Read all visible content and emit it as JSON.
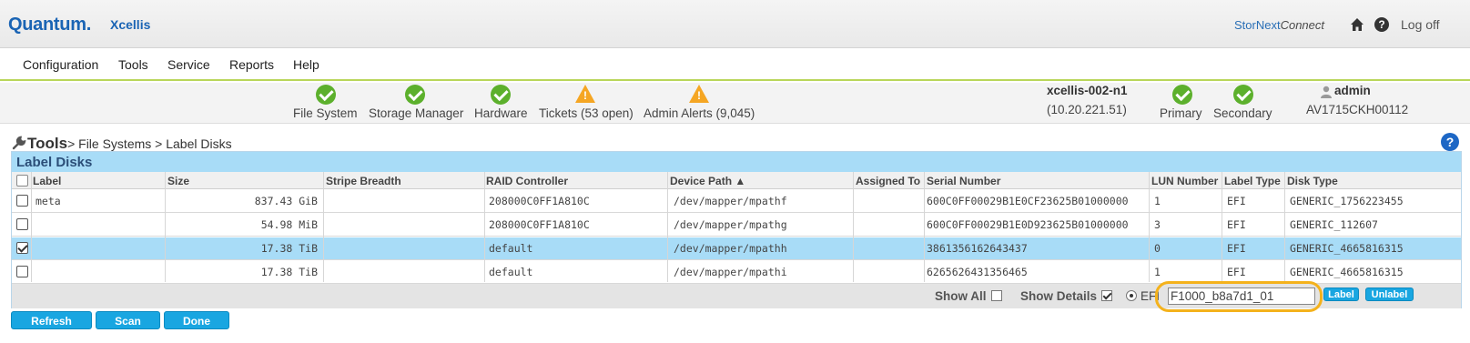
{
  "header": {
    "brand": "Quantum",
    "brand_dot": ".",
    "product": "Xcellis",
    "stornext_a": "StorNext",
    "stornext_b": "Connect",
    "help_icon": "?",
    "logoff": "Log off"
  },
  "menu": [
    "Configuration",
    "Tools",
    "Service",
    "Reports",
    "Help"
  ],
  "status": {
    "items": [
      {
        "label": "File System",
        "state": "ok"
      },
      {
        "label": "Storage Manager",
        "state": "ok"
      },
      {
        "label": "Hardware",
        "state": "ok"
      },
      {
        "label": "Tickets (53 open)",
        "state": "warn"
      },
      {
        "label": "Admin Alerts (9,045)",
        "state": "warn"
      }
    ],
    "warn_glyph": "!",
    "node_name": "xcellis-002-n1",
    "node_ip": "(10.20.221.51)",
    "primary": "Primary",
    "secondary": "Secondary",
    "user": "admin",
    "serial": "AV1715CKH00112"
  },
  "breadcrumb": {
    "root": "Tools",
    "path": "> File Systems > Label Disks",
    "help": "?"
  },
  "panel": {
    "title": "Label Disks",
    "columns": {
      "label": "Label",
      "size": "Size",
      "stripe": "Stripe Breadth",
      "raid": "RAID Controller",
      "device": "Device Path",
      "device_sort": "▲",
      "assigned": "Assigned To",
      "serial": "Serial Number",
      "lun": "LUN Number",
      "label_type": "Label Type",
      "disk_type": "Disk Type"
    },
    "rows": [
      {
        "checked": false,
        "label": "meta",
        "size": "837.43 GiB",
        "stripe": "",
        "raid": "208000C0FF1A810C",
        "device": "/dev/mapper/mpathf",
        "assigned": "",
        "serial": "600C0FF00029B1E0CF23625B01000000",
        "lun": "1",
        "label_type": "EFI",
        "disk_type": "GENERIC_1756223455"
      },
      {
        "checked": false,
        "label": "",
        "size": "54.98 MiB",
        "stripe": "",
        "raid": "208000C0FF1A810C",
        "device": "/dev/mapper/mpathg",
        "assigned": "",
        "serial": "600C0FF00029B1E0D923625B01000000",
        "lun": "3",
        "label_type": "EFI",
        "disk_type": "GENERIC_112607"
      },
      {
        "checked": true,
        "label": "",
        "size": "17.38 TiB",
        "stripe": "",
        "raid": "default",
        "device": "/dev/mapper/mpathh",
        "assigned": "",
        "serial": "3861356162643437",
        "lun": "0",
        "label_type": "EFI",
        "disk_type": "GENERIC_4665816315"
      },
      {
        "checked": false,
        "label": "",
        "size": "17.38 TiB",
        "stripe": "",
        "raid": "default",
        "device": "/dev/mapper/mpathi",
        "assigned": "",
        "serial": "6265626431356465",
        "lun": "1",
        "label_type": "EFI",
        "disk_type": "GENERIC_4665816315"
      }
    ],
    "footer": {
      "show_all": "Show All",
      "show_all_checked": false,
      "show_details": "Show Details",
      "show_details_checked": true,
      "efi": "EFI",
      "label_value": "F1000_b8a7d1_01",
      "label_button": "Label",
      "unlabel_button": "Unlabel"
    }
  },
  "actions": {
    "refresh": "Refresh",
    "scan": "Scan",
    "done": "Done"
  },
  "colors": {
    "accent": "#19a6e1",
    "selected_row": "#a8dcf7",
    "ok": "#5cb02c",
    "warn": "#f5a623",
    "highlight": "#f4b21c",
    "brand": "#1a64b4"
  }
}
